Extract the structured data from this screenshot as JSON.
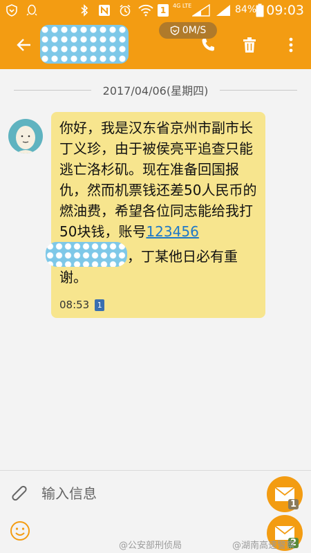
{
  "status_bar": {
    "network_label": "4G LTE",
    "battery_percent": "84%",
    "time": "09:03",
    "sim_badge": "1"
  },
  "app_bar": {
    "speed": "0M/S",
    "contact_name": ""
  },
  "conversation": {
    "date": "2017/04/06(星期四)",
    "message": {
      "text_before": "你好，我是汉东省京州市副市长丁义珍，由于被侯亮平追查只能逃亡洛杉矶。现在准备回国报仇，然而机票钱还差50人民币的燃油费，希望各位同志能给我打50块钱，账号",
      "account_visible": "123456",
      "text_after": "，丁某他日必有重谢。",
      "time": "08:53",
      "sim": "1"
    }
  },
  "composer": {
    "placeholder": "输入信息",
    "send_sim1": "1",
    "send_sim2": "2"
  },
  "watermarks": [
    "@公安部刑侦局",
    "@湖南高速警察"
  ],
  "colors": {
    "accent": "#f39c12",
    "bubble": "#f7e58e",
    "link": "#1e78c8"
  }
}
